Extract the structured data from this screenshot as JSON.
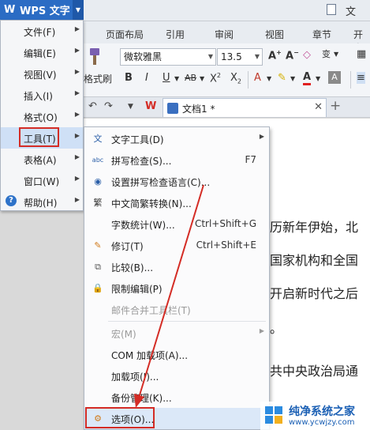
{
  "app": {
    "name": "WPS 文字",
    "window_title": "文"
  },
  "ribbon_tabs": [
    "页面布局",
    "引用",
    "审阅",
    "视图",
    "章节",
    "开发"
  ],
  "ribbon": {
    "format_painter_label": "格式刷",
    "font_name": "微软雅黑",
    "font_size": "13.5"
  },
  "doc_tab": {
    "name": "文档1 *"
  },
  "main_menu": {
    "items": [
      {
        "label": "文件(F)"
      },
      {
        "label": "编辑(E)"
      },
      {
        "label": "视图(V)"
      },
      {
        "label": "插入(I)"
      },
      {
        "label": "格式(O)"
      },
      {
        "label": "工具(T)"
      },
      {
        "label": "表格(A)"
      },
      {
        "label": "窗口(W)"
      },
      {
        "label": "帮助(H)"
      }
    ]
  },
  "tools_menu": {
    "items": [
      {
        "label": "文字工具(D)",
        "shortcut": ""
      },
      {
        "label": "拼写检查(S)...",
        "shortcut": "F7"
      },
      {
        "label": "设置拼写检查语言(C)...",
        "shortcut": ""
      },
      {
        "label": "中文简繁转换(N)...",
        "shortcut": ""
      },
      {
        "label": "字数统计(W)...",
        "shortcut": "Ctrl+Shift+G"
      },
      {
        "label": "修订(T)",
        "shortcut": "Ctrl+Shift+E"
      },
      {
        "label": "比较(B)...",
        "shortcut": ""
      },
      {
        "label": "限制编辑(P)",
        "shortcut": ""
      },
      {
        "label": "邮件合并工具栏(T)",
        "shortcut": ""
      },
      {
        "label": "宏(M)",
        "shortcut": ""
      },
      {
        "label": "COM 加载项(A)...",
        "shortcut": ""
      },
      {
        "label": "加载项(I)...",
        "shortcut": ""
      },
      {
        "label": "备份管理(K)...",
        "shortcut": ""
      },
      {
        "label": "选项(O)...",
        "shortcut": ""
      }
    ]
  },
  "document": {
    "lines": [
      "历新年伊始，北",
      "国家机构和全国",
      "开启新时代之后",
      "。",
      "共中央政治局通"
    ]
  },
  "watermark": {
    "title": "纯净系统之家",
    "url": "www.ycwjzy.com"
  },
  "colors": {
    "wps_blue": "#2b6cc4",
    "highlight_red": "#d42c25"
  }
}
